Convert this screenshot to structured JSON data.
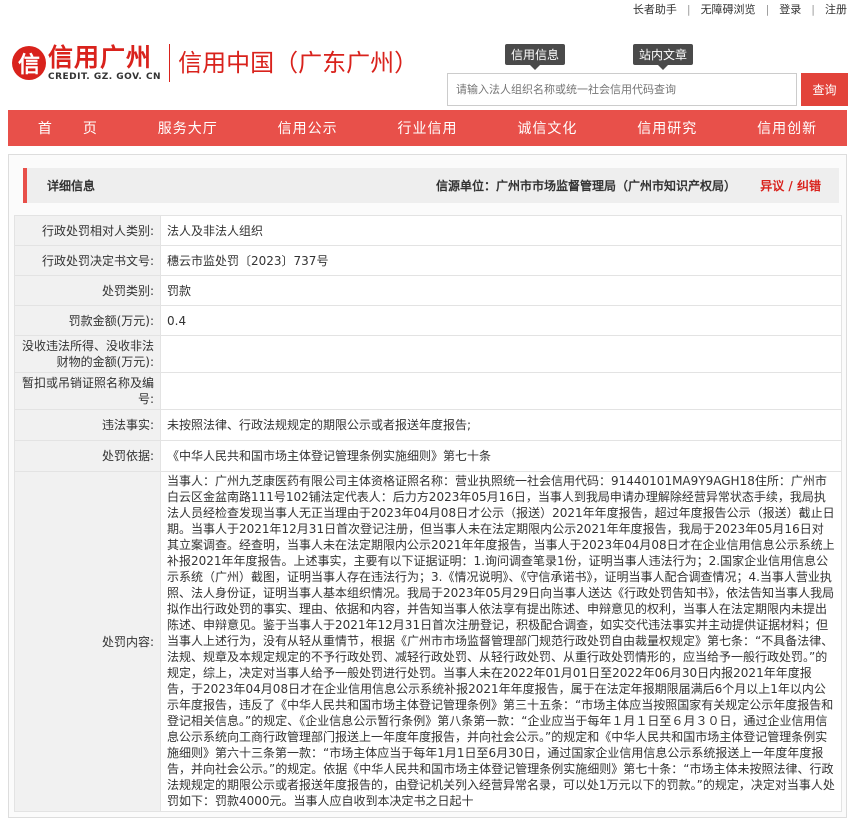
{
  "topbar": {
    "elder": "长者助手",
    "accessible": "无障碍浏览",
    "login": "登录",
    "register": "注册"
  },
  "header": {
    "logo_mark": "信",
    "logo_cn": "信用广州",
    "logo_en": "CREDIT. GZ. GOV. CN",
    "subtitle": "信用中国（广东广州）",
    "tag_credit_info": "信用信息",
    "tag_site_article": "站内文章",
    "search_placeholder": "请输入法人组织名称或统一社会信用代码查询",
    "search_button": "查询"
  },
  "nav": {
    "items": [
      "首　　页",
      "服务大厅",
      "信用公示",
      "行业信用",
      "诚信文化",
      "信用研究",
      "信用创新"
    ]
  },
  "detail": {
    "title": "详细信息",
    "source": "信源单位：广州市市场监督管理局（广州市知识产权局）",
    "objection": "异议 / 纠错"
  },
  "rows": [
    {
      "label": "行政处罚相对人类别:",
      "value": "法人及非法人组织"
    },
    {
      "label": "行政处罚决定书文号:",
      "value": "穗云市监处罚〔2023〕737号"
    },
    {
      "label": "处罚类别:",
      "value": "罚款"
    },
    {
      "label": "罚款金额(万元):",
      "value": "0.4"
    },
    {
      "label": "没收违法所得、没收非法财物的金额(万元):",
      "value": ""
    },
    {
      "label": "暂扣或吊销证照名称及编号:",
      "value": ""
    },
    {
      "label": "违法事实:",
      "value": "未按照法律、行政法规规定的期限公示或者报送年度报告;"
    },
    {
      "label": "处罚依据:",
      "value": "《中华人民共和国市场主体登记管理条例实施细则》第七十条"
    },
    {
      "label": "处罚内容:",
      "value": "当事人：广州九芝康医药有限公司主体资格证照名称：营业执照统一社会信用代码：91440101MA9Y9AGH18住所：广州市白云区金盆南路111号102铺法定代表人：后力方2023年05月16日，当事人到我局申请办理解除经营异常状态手续，我局执法人员经检查发现当事人无正当理由于2023年04月08日才公示（报送）2021年年度报告，超过年度报告公示（报送）截止日期。当事人于2021年12月31日首次登记注册，但当事人未在法定期限内公示2021年年度报告，我局于2023年05月16日对其立案调查。经查明，当事人未在法定期限内公示2021年年度报告，当事人于2023年04月08日才在企业信用信息公示系统上补报2021年年度报告。上述事实，主要有以下证据证明：1.询问调查笔录1份，证明当事人违法行为；2.国家企业信用信息公示系统（广州）截图，证明当事人存在违法行为；3.《情况说明》、《守信承诺书》，证明当事人配合调查情况；4.当事人营业执照、法人身份证，证明当事人基本组织情况。我局于2023年05月29日向当事人送达《行政处罚告知书》，依法告知当事人我局拟作出行政处罚的事实、理由、依据和内容，并告知当事人依法享有提出陈述、申辩意见的权利，当事人在法定期限内未提出陈述、申辩意见。鉴于当事人于2021年12月31日首次注册登记，积极配合调查，如实交代违法事实并主动提供证据材料；但当事人上述行为，没有从轻从重情节，根据《广州市市场监督管理部门规范行政处罚自由裁量权规定》第七条：“不具备法律、法规、规章及本规定规定的不予行政处罚、减轻行政处罚、从轻行政处罚、从重行政处罚情形的，应当给予一般行政处罚。”的规定，综上，决定对当事人给予一般处罚进行处罚。当事人未在2022年01月01日至2022年06月30日内报2021年年度报告，于2023年04月08日才在企业信用信息公示系统补报2021年年度报告，属于在法定年报期限届满后6个月以上1年以内公示年度报告，违反了《中华人民共和国市场主体登记管理条例》第三十五条：“市场主体应当按照国家有关规定公示年度报告和登记相关信息。”的规定、《企业信息公示暂行条例》第八条第一款：“企业应当于每年１月１日至６月３０日，通过企业信用信息公示系统向工商行政管理部门报送上一年度年度报告，并向社会公示。”的规定和《中华人民共和国市场主体登记管理条例实施细则》第六十三条第一款：“市场主体应当于每年1月1日至6月30日，通过国家企业信用信息公示系统报送上一年度年度报告，并向社会公示。”的规定。依据《中华人民共和国市场主体登记管理条例实施细则》第七十条：“市场主体未按照法律、行政法规规定的期限公示或者报送年度报告的，由登记机关列入经营异常名录，可以处1万元以下的罚款。”的规定，决定对当事人处罚如下：罚款4000元。当事人应自收到本决定书之日起十"
    }
  ]
}
